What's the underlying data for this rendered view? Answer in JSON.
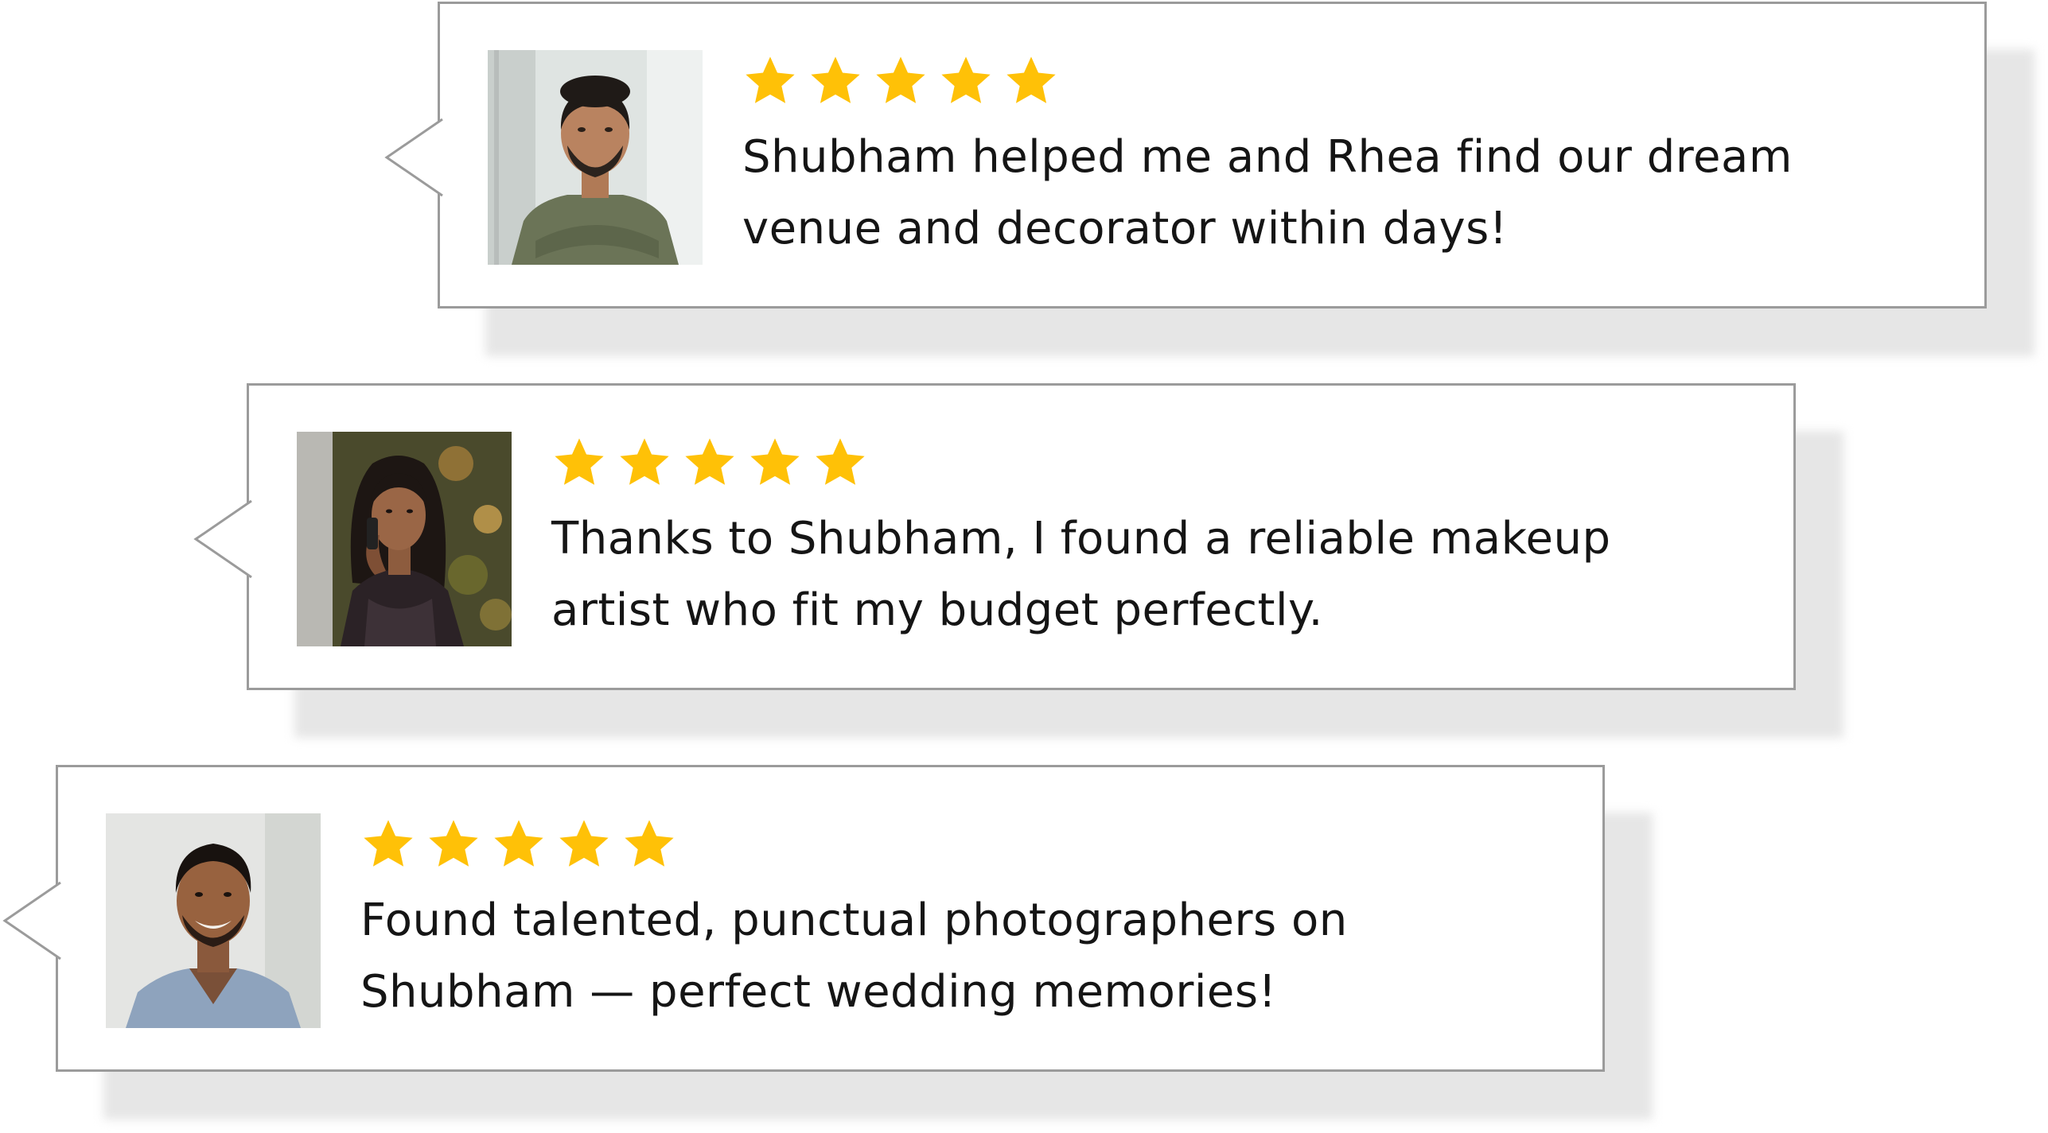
{
  "reviews": [
    {
      "avatar": "man-olive-shirt-arms-crossed-photo",
      "rating": 5,
      "text": "Shubham helped me and Rhea find our dream venue and decorator within days!"
    },
    {
      "avatar": "woman-on-phone-photo",
      "rating": 5,
      "text": "Thanks to Shubham, I found a reliable makeup artist who fit my budget perfectly."
    },
    {
      "avatar": "smiling-man-blue-shirt-photo",
      "rating": 5,
      "text": "Found talented, punctual photographers on Shubham — perfect wedding memories!"
    }
  ],
  "colors": {
    "star": "#FFC107",
    "card_border": "#9b9b9b",
    "shadow": "#e6e6e6",
    "text": "#151515"
  },
  "icons": {
    "rating_star": "star-icon",
    "bubble_tail": "speech-bubble-pointer"
  }
}
